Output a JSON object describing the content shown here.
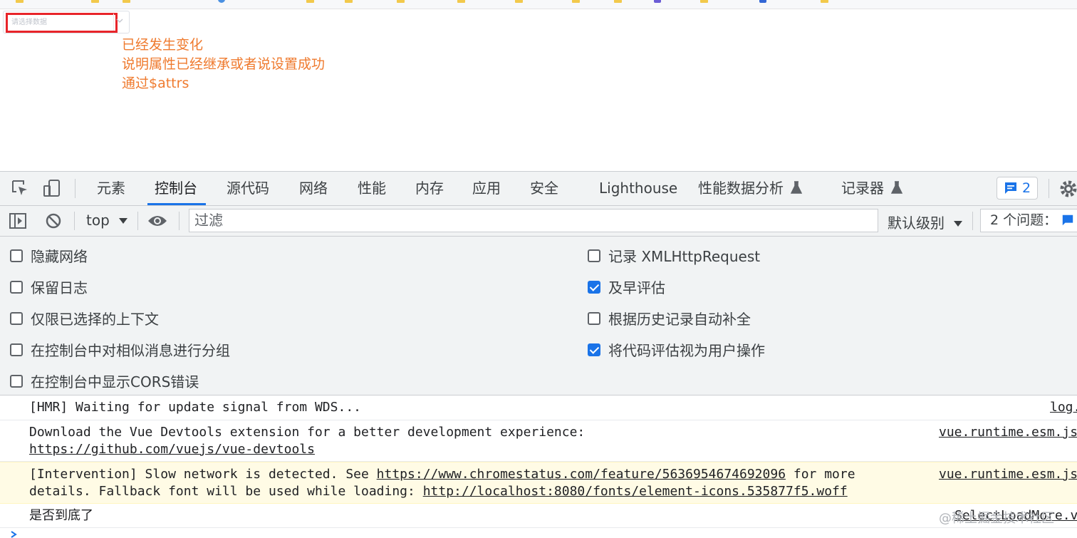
{
  "page": {
    "select_placeholder": "请选择数据",
    "annotation_lines": [
      "已经发生变化",
      "说明属性已经继承或者说设置成功",
      "通过$attrs"
    ]
  },
  "devtools": {
    "tabs": [
      "元素",
      "控制台",
      "源代码",
      "网络",
      "性能",
      "内存",
      "应用",
      "安全",
      "Lighthouse",
      "性能数据分析",
      "记录器"
    ],
    "active_tab": "控制台",
    "issues_count": "2",
    "console_toolbar": {
      "context": "top",
      "filter_placeholder": "过滤",
      "levels": "默认级别",
      "issues": "2 个问题："
    },
    "settings_left": [
      {
        "label": "隐藏网络",
        "checked": false
      },
      {
        "label": "保留日志",
        "checked": false
      },
      {
        "label": "仅限已选择的上下文",
        "checked": false
      },
      {
        "label": "在控制台中对相似消息进行分组",
        "checked": false
      },
      {
        "label": "在控制台中显示CORS错误",
        "checked": false
      }
    ],
    "settings_right": [
      {
        "label": "记录 XMLHttpRequest",
        "checked": false
      },
      {
        "label": "及早评估",
        "checked": true
      },
      {
        "label": "根据历史记录自动补全",
        "checked": false
      },
      {
        "label": "将代码评估视为用户操作",
        "checked": true
      }
    ],
    "messages": [
      {
        "text": "[HMR] Waiting for update signal from WDS...",
        "source": "log."
      },
      {
        "line1": "Download the Vue Devtools extension for a better development experience:",
        "link": "https://github.com/vuejs/vue-devtools",
        "source": "vue.runtime.esm.js"
      },
      {
        "prefix": "[Intervention] Slow network is detected. See ",
        "link1": "https://www.chromestatus.com/feature/5636954674692096",
        "suffix": " for more",
        "line2_prefix": "details. Fallback font will be used while loading: ",
        "link2": "http://localhost:8080/fonts/element-icons.535877f5.woff",
        "source": "vue.runtime.esm.js"
      },
      {
        "text": "是否到底了",
        "source": "SelectLoadMore.v"
      }
    ],
    "watermark": "@稀土掘金技术社区"
  }
}
